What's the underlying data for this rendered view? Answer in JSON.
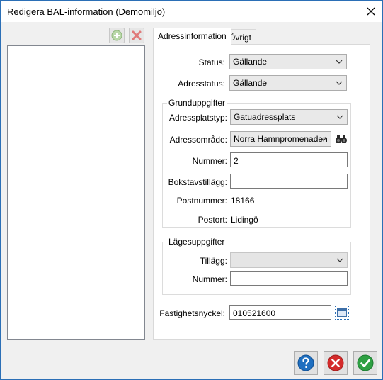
{
  "window": {
    "title": "Redigera BAL-information (Demomiljö)"
  },
  "toolbar": {
    "add_icon": "plus-circle-icon",
    "delete_icon": "red-x-icon"
  },
  "tabs": [
    {
      "label": "Adressinformation",
      "active": true
    },
    {
      "label": "Övrigt",
      "active": false
    }
  ],
  "form": {
    "status": {
      "label": "Status:",
      "value": "Gällande"
    },
    "adresstatus": {
      "label": "Adresstatus:",
      "value": "Gällande"
    },
    "grunduppgifter": {
      "legend": "Grunduppgifter",
      "adressplatstyp": {
        "label": "Adressplatstyp:",
        "value": "Gatuadressplats"
      },
      "adressomrade": {
        "label": "Adressområde:",
        "value": "Norra Hamnpromenaden"
      },
      "nummer": {
        "label": "Nummer:",
        "value": "2"
      },
      "bokstavstillagg": {
        "label": "Bokstavstillägg:",
        "value": ""
      },
      "postnummer": {
        "label": "Postnummer:",
        "value": "18166"
      },
      "postort": {
        "label": "Postort:",
        "value": "Lidingö"
      }
    },
    "lagesuppgifter": {
      "legend": "Lägesuppgifter",
      "tillagg": {
        "label": "Tillägg:",
        "value": ""
      },
      "nummer": {
        "label": "Nummer:",
        "value": ""
      }
    },
    "fastighetsnyckel": {
      "label": "Fastighetsnyckel:",
      "value": "010521600"
    }
  },
  "buttons": {
    "help_icon": "help-icon",
    "cancel_icon": "cancel-icon",
    "ok_icon": "ok-icon"
  },
  "colors": {
    "accent": "#2b6fb6",
    "help": "#1f6fc0",
    "cancel": "#d42a2a",
    "ok": "#2ea043"
  }
}
